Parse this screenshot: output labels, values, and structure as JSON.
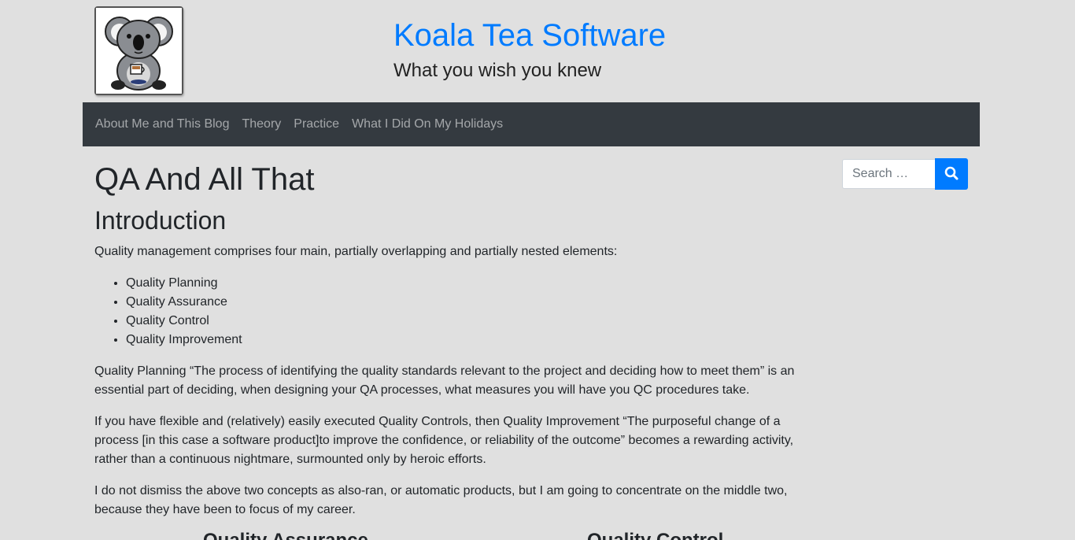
{
  "header": {
    "site_title": "Koala Tea Software",
    "tagline": "What you wish you knew",
    "logo_icon": "koala-drinking-tea-icon"
  },
  "nav": {
    "items": [
      {
        "label": "About Me and This Blog"
      },
      {
        "label": "Theory"
      },
      {
        "label": "Practice"
      },
      {
        "label": "What I Did On My Holidays"
      }
    ]
  },
  "search": {
    "placeholder": "Search …",
    "button_icon": "search-icon"
  },
  "article": {
    "title": "QA And All That",
    "section_title": "Introduction",
    "intro": "Quality management comprises four main, partially overlapping and partially nested elements:",
    "bullets": [
      "Quality Planning",
      "Quality Assurance",
      "Quality Control",
      "Quality Improvement"
    ],
    "paragraphs": [
      "Quality Planning “The process of identifying the quality standards relevant to the project and deciding how to meet them” is an essential part of deciding, when designing your QA processes, what measures you will have you QC procedures take.",
      "If you have flexible and (relatively) easily executed Quality Controls, then Quality Improvement “The purposeful change of a process [in this case a software product]to improve the confidence, or reliability of the outcome” becomes a rewarding activity, rather than a continuous nightmare, surmounted only by heroic efforts.",
      "I do not dismiss the above two concepts as also-ran, or automatic products, but I am going to concentrate on the middle two, because they have been to focus of my career."
    ],
    "subheads": [
      "Quality Assurance",
      "Quality Control"
    ]
  },
  "colors": {
    "accent": "#007bff",
    "navbar": "#343a40",
    "background": "#e0e0e0"
  }
}
